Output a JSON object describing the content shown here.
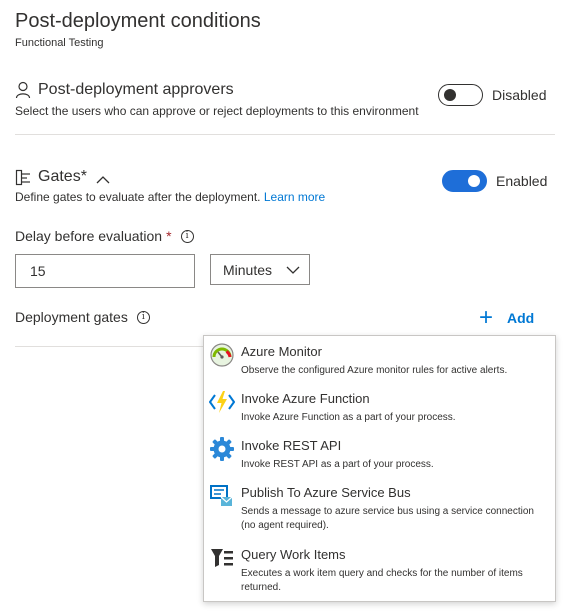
{
  "header": {
    "title": "Post-deployment conditions",
    "subtitle": "Functional Testing"
  },
  "approvers": {
    "label": "Post-deployment approvers",
    "description": "Select the users who can approve or reject deployments to this environment",
    "toggle_state": "off",
    "toggle_label": "Disabled"
  },
  "gates": {
    "label": "Gates*",
    "description": "Define gates to evaluate after the deployment.",
    "learn_more": "Learn more",
    "toggle_state": "on",
    "toggle_label": "Enabled"
  },
  "delay": {
    "label": "Delay before evaluation",
    "required_mark": "*",
    "value": "15",
    "unit": "Minutes"
  },
  "deployment_gates": {
    "label": "Deployment gates",
    "add_label": "Add"
  },
  "gate_menu": {
    "items": [
      {
        "icon": "azure-monitor-icon",
        "title": "Azure Monitor",
        "description": "Observe the configured Azure monitor rules for active alerts."
      },
      {
        "icon": "azure-function-icon",
        "title": "Invoke Azure Function",
        "description": "Invoke Azure Function as a part of your process."
      },
      {
        "icon": "rest-api-icon",
        "title": "Invoke REST API",
        "description": "Invoke REST API as a part of your process."
      },
      {
        "icon": "service-bus-icon",
        "title": "Publish To Azure Service Bus",
        "description": "Sends a message to azure service bus using a service connection (no agent required)."
      },
      {
        "icon": "query-work-items-icon",
        "title": "Query Work Items",
        "description": "Executes a work item query and checks for the number of items returned."
      }
    ]
  },
  "colors": {
    "accent": "#0078d4",
    "toggle_on": "#1e6ed8",
    "required": "#a4262c"
  }
}
